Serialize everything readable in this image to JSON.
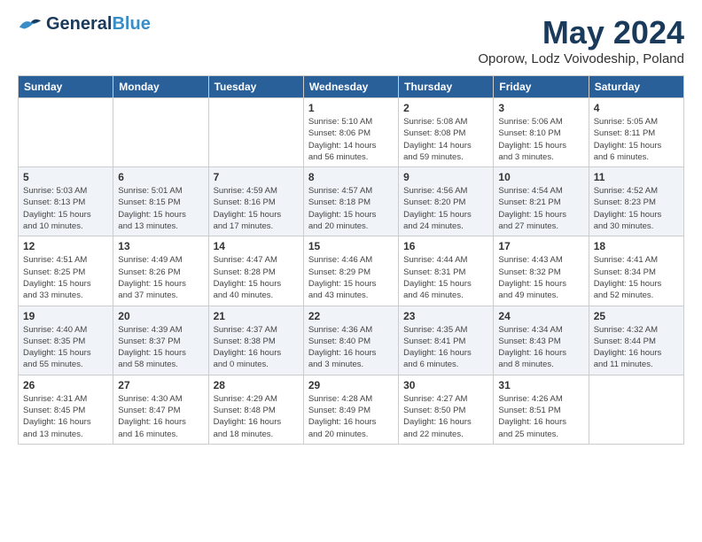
{
  "header": {
    "logo_general": "General",
    "logo_blue": "Blue",
    "title": "May 2024",
    "location": "Oporow, Lodz Voivodeship, Poland"
  },
  "days_of_week": [
    "Sunday",
    "Monday",
    "Tuesday",
    "Wednesday",
    "Thursday",
    "Friday",
    "Saturday"
  ],
  "weeks": [
    [
      {
        "day": "",
        "info": ""
      },
      {
        "day": "",
        "info": ""
      },
      {
        "day": "",
        "info": ""
      },
      {
        "day": "1",
        "info": "Sunrise: 5:10 AM\nSunset: 8:06 PM\nDaylight: 14 hours\nand 56 minutes."
      },
      {
        "day": "2",
        "info": "Sunrise: 5:08 AM\nSunset: 8:08 PM\nDaylight: 14 hours\nand 59 minutes."
      },
      {
        "day": "3",
        "info": "Sunrise: 5:06 AM\nSunset: 8:10 PM\nDaylight: 15 hours\nand 3 minutes."
      },
      {
        "day": "4",
        "info": "Sunrise: 5:05 AM\nSunset: 8:11 PM\nDaylight: 15 hours\nand 6 minutes."
      }
    ],
    [
      {
        "day": "5",
        "info": "Sunrise: 5:03 AM\nSunset: 8:13 PM\nDaylight: 15 hours\nand 10 minutes."
      },
      {
        "day": "6",
        "info": "Sunrise: 5:01 AM\nSunset: 8:15 PM\nDaylight: 15 hours\nand 13 minutes."
      },
      {
        "day": "7",
        "info": "Sunrise: 4:59 AM\nSunset: 8:16 PM\nDaylight: 15 hours\nand 17 minutes."
      },
      {
        "day": "8",
        "info": "Sunrise: 4:57 AM\nSunset: 8:18 PM\nDaylight: 15 hours\nand 20 minutes."
      },
      {
        "day": "9",
        "info": "Sunrise: 4:56 AM\nSunset: 8:20 PM\nDaylight: 15 hours\nand 24 minutes."
      },
      {
        "day": "10",
        "info": "Sunrise: 4:54 AM\nSunset: 8:21 PM\nDaylight: 15 hours\nand 27 minutes."
      },
      {
        "day": "11",
        "info": "Sunrise: 4:52 AM\nSunset: 8:23 PM\nDaylight: 15 hours\nand 30 minutes."
      }
    ],
    [
      {
        "day": "12",
        "info": "Sunrise: 4:51 AM\nSunset: 8:25 PM\nDaylight: 15 hours\nand 33 minutes."
      },
      {
        "day": "13",
        "info": "Sunrise: 4:49 AM\nSunset: 8:26 PM\nDaylight: 15 hours\nand 37 minutes."
      },
      {
        "day": "14",
        "info": "Sunrise: 4:47 AM\nSunset: 8:28 PM\nDaylight: 15 hours\nand 40 minutes."
      },
      {
        "day": "15",
        "info": "Sunrise: 4:46 AM\nSunset: 8:29 PM\nDaylight: 15 hours\nand 43 minutes."
      },
      {
        "day": "16",
        "info": "Sunrise: 4:44 AM\nSunset: 8:31 PM\nDaylight: 15 hours\nand 46 minutes."
      },
      {
        "day": "17",
        "info": "Sunrise: 4:43 AM\nSunset: 8:32 PM\nDaylight: 15 hours\nand 49 minutes."
      },
      {
        "day": "18",
        "info": "Sunrise: 4:41 AM\nSunset: 8:34 PM\nDaylight: 15 hours\nand 52 minutes."
      }
    ],
    [
      {
        "day": "19",
        "info": "Sunrise: 4:40 AM\nSunset: 8:35 PM\nDaylight: 15 hours\nand 55 minutes."
      },
      {
        "day": "20",
        "info": "Sunrise: 4:39 AM\nSunset: 8:37 PM\nDaylight: 15 hours\nand 58 minutes."
      },
      {
        "day": "21",
        "info": "Sunrise: 4:37 AM\nSunset: 8:38 PM\nDaylight: 16 hours\nand 0 minutes."
      },
      {
        "day": "22",
        "info": "Sunrise: 4:36 AM\nSunset: 8:40 PM\nDaylight: 16 hours\nand 3 minutes."
      },
      {
        "day": "23",
        "info": "Sunrise: 4:35 AM\nSunset: 8:41 PM\nDaylight: 16 hours\nand 6 minutes."
      },
      {
        "day": "24",
        "info": "Sunrise: 4:34 AM\nSunset: 8:43 PM\nDaylight: 16 hours\nand 8 minutes."
      },
      {
        "day": "25",
        "info": "Sunrise: 4:32 AM\nSunset: 8:44 PM\nDaylight: 16 hours\nand 11 minutes."
      }
    ],
    [
      {
        "day": "26",
        "info": "Sunrise: 4:31 AM\nSunset: 8:45 PM\nDaylight: 16 hours\nand 13 minutes."
      },
      {
        "day": "27",
        "info": "Sunrise: 4:30 AM\nSunset: 8:47 PM\nDaylight: 16 hours\nand 16 minutes."
      },
      {
        "day": "28",
        "info": "Sunrise: 4:29 AM\nSunset: 8:48 PM\nDaylight: 16 hours\nand 18 minutes."
      },
      {
        "day": "29",
        "info": "Sunrise: 4:28 AM\nSunset: 8:49 PM\nDaylight: 16 hours\nand 20 minutes."
      },
      {
        "day": "30",
        "info": "Sunrise: 4:27 AM\nSunset: 8:50 PM\nDaylight: 16 hours\nand 22 minutes."
      },
      {
        "day": "31",
        "info": "Sunrise: 4:26 AM\nSunset: 8:51 PM\nDaylight: 16 hours\nand 25 minutes."
      },
      {
        "day": "",
        "info": ""
      }
    ]
  ]
}
